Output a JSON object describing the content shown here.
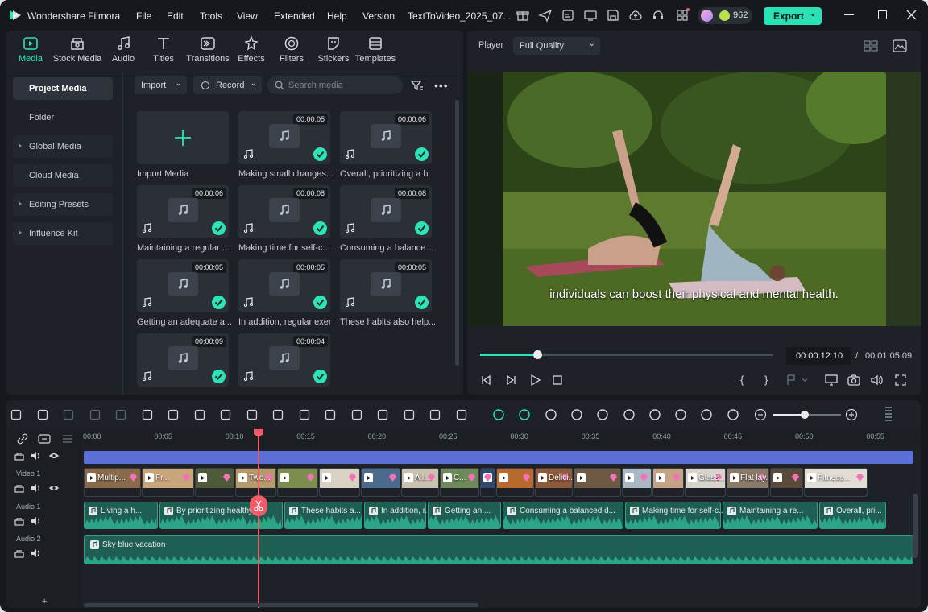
{
  "app": {
    "name": "Wondershare Filmora",
    "project": "TextToVideo_2025_07...",
    "credits": "962",
    "export": "Export"
  },
  "menu": [
    "File",
    "Edit",
    "Tools",
    "View",
    "Extended",
    "Help",
    "Version"
  ],
  "tabs": [
    {
      "label": "Media",
      "icon": "media-icon"
    },
    {
      "label": "Stock Media",
      "icon": "stock-media-icon"
    },
    {
      "label": "Audio",
      "icon": "audio-icon"
    },
    {
      "label": "Titles",
      "icon": "titles-icon"
    },
    {
      "label": "Transitions",
      "icon": "transitions-icon"
    },
    {
      "label": "Effects",
      "icon": "effects-icon"
    },
    {
      "label": "Filters",
      "icon": "filters-icon"
    },
    {
      "label": "Stickers",
      "icon": "stickers-icon"
    },
    {
      "label": "Templates",
      "icon": "templates-icon"
    }
  ],
  "sidebar": [
    {
      "label": "Project Media",
      "active": true
    },
    {
      "label": "Folder"
    },
    {
      "label": "Global Media",
      "arrow": true
    },
    {
      "label": "Cloud Media"
    },
    {
      "label": "Editing Presets",
      "arrow": true
    },
    {
      "label": "Influence Kit",
      "arrow": true
    }
  ],
  "media_toolbar": {
    "import": "Import",
    "record": "Record",
    "search_placeholder": "Search media"
  },
  "import_card": "Import Media",
  "media": [
    {
      "duration": "00:00:05",
      "label": "Making small changes..."
    },
    {
      "duration": "00:00:06",
      "label": "Overall, prioritizing a h"
    },
    {
      "duration": "00:00:06",
      "label": "Maintaining a regular ..."
    },
    {
      "duration": "00:00:08",
      "label": "Making time for self-c..."
    },
    {
      "duration": "00:00:08",
      "label": "Consuming a balance..."
    },
    {
      "duration": "00:00:05",
      "label": "Getting an adequate a..."
    },
    {
      "duration": "00:00:05",
      "label": "In addition, regular exer"
    },
    {
      "duration": "00:00:05",
      "label": "These habits also help..."
    },
    {
      "duration": "00:00:09",
      "label": ""
    },
    {
      "duration": "00:00:04",
      "label": ""
    }
  ],
  "player": {
    "label": "Player",
    "quality": "Full Quality",
    "caption": "individuals can boost their physical and mental health.",
    "current_time": "00:00:12:10",
    "separator": "/",
    "total_time": "00:01:05:09",
    "progress": 0.2
  },
  "timeline": {
    "ruler": [
      "00:00",
      "00:05",
      "00:10",
      "00:15",
      "00:20",
      "00:25",
      "00:30",
      "00:35",
      "00:40",
      "00:45",
      "00:50",
      "00:55"
    ],
    "tracks": {
      "video": "Video 1",
      "audio1": "Audio 1",
      "audio2": "Audio 2"
    },
    "video_clips": [
      "Multip...",
      "Fr...",
      "",
      "Two...",
      "",
      "",
      "",
      "A l...",
      "C...",
      "",
      "",
      "Delici...",
      "",
      "",
      "",
      "Glass...",
      "Flat lay...",
      "",
      "Fitness..."
    ],
    "audio_clips": [
      "Living a h...",
      "By prioritizing healthy ...",
      "These habits a...",
      "In addition, r...",
      "Getting an ...",
      "Consuming a balanced d...",
      "Making time for self-c...",
      "Maintaining a re...",
      "Overall, pri..."
    ],
    "music": "Sky blue vacation",
    "add": "+"
  },
  "colors": {
    "accent": "#2de3b7",
    "playhead": "#f45b69",
    "title_track": "#5b6fd6"
  }
}
